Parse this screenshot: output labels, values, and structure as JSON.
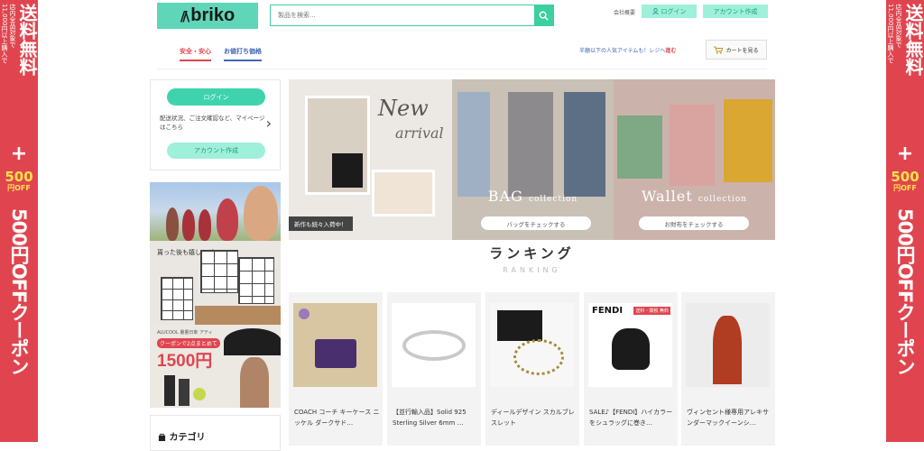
{
  "side_banner": {
    "line1": "送料無料",
    "line2": "店内全品対象で",
    "line3": "11,000円以上購入で",
    "plus": "+",
    "amount": "500",
    "off": "円OFF",
    "coupon": "500円OFFクーポン"
  },
  "header": {
    "logo_text": "briko",
    "search_placeholder": "製品を検索...",
    "company_link": "会社概要",
    "login_label": "ログイン",
    "account_label": "アカウント作成",
    "tabs": [
      "安全・安心",
      "お値打ち価格"
    ],
    "promo_text": "半額以下の人気アイテムも！レジへ",
    "promo_emph": "進む",
    "cart_label": "カートを見る"
  },
  "sidebar": {
    "login_label": "ログイン",
    "info_text": "配送状況、ご注文確認など、マイページはこちら",
    "account_label": "アカウント作成",
    "gift_title": "貰った後も嬉しいギフト。",
    "ad3_small": "ALUCOOL 暑量日傘 アティ",
    "ad3_badge": "クーポンで2点まとめて",
    "ad3_price": "1500円",
    "category_label": "カテゴリ"
  },
  "hero": {
    "new_title": "New",
    "new_sub": "arrival",
    "new_tag": "新作も続々入荷中！",
    "bag_title": "BAG",
    "bag_title_small": "collection",
    "bag_button": "バッグをチェックする",
    "wallet_title": "Wallet",
    "wallet_title_small": "collection",
    "wallet_button": "お財布をチェックする"
  },
  "ranking": {
    "title": "ランキング",
    "subtitle": "RANKING"
  },
  "products": [
    {
      "name": "COACH コーチ キーケース ニッケル ダークサド…"
    },
    {
      "name": "【並行輸入品】Solid 925 Sterling Silver 6mm …"
    },
    {
      "name": "ディールデザイン スカルブレスレット"
    },
    {
      "name": "SALE♪【FENDI】ハイカラーをシュラッグに巻き…",
      "brand": "FENDI",
      "tag": "送料・関税 無料"
    },
    {
      "name": "ヴィンセント様専用アレキサンダーマックイーンシ…"
    }
  ],
  "colors": {
    "accent": "#3ccf9f",
    "banner_red": "#e0454f",
    "link_blue": "#3f67b8"
  }
}
